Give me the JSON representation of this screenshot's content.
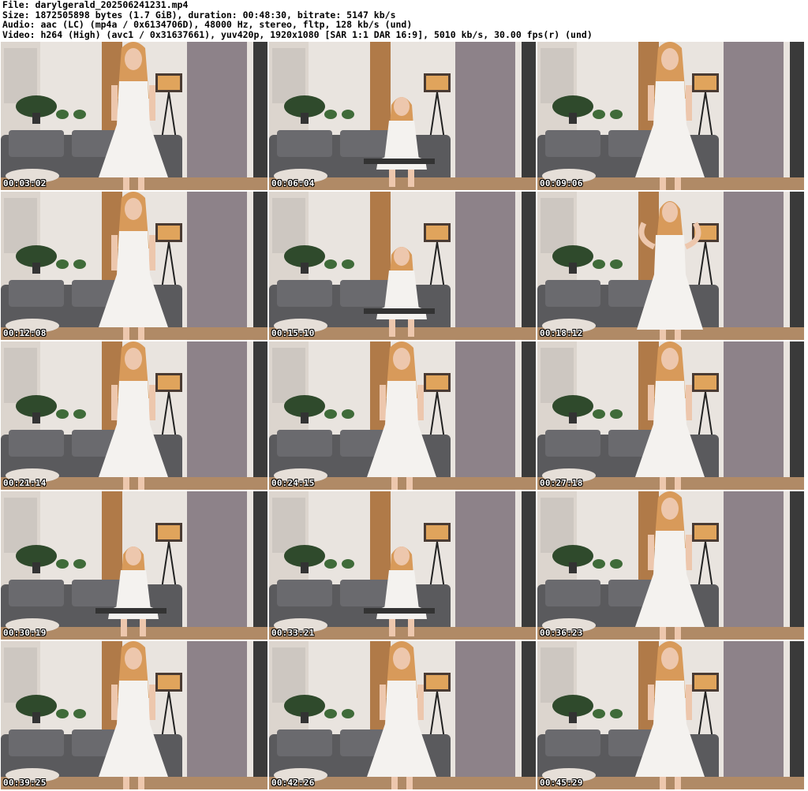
{
  "header": {
    "file_line": "File: darylgerald_202506241231.mp4",
    "size_line": "Size: 1872505898 bytes (1.7 GiB), duration: 00:48:30, bitrate: 5147 kb/s",
    "audio_line": "Audio: aac (LC) (mp4a / 0x6134706D), 48000 Hz, stereo, fltp, 128 kb/s (und)",
    "video_line": "Video: h264 (High) (avc1 / 0x31637661), yuv420p, 1920x1080 [SAR 1:1 DAR 16:9], 5010 kb/s, 30.00 fps(r) (und)"
  },
  "thumbnails": [
    {
      "time": "00:03:02",
      "pose": "standing"
    },
    {
      "time": "00:06:04",
      "pose": "sitting"
    },
    {
      "time": "00:09:06",
      "pose": "standing"
    },
    {
      "time": "00:12:08",
      "pose": "standing"
    },
    {
      "time": "00:15:10",
      "pose": "sitting"
    },
    {
      "time": "00:18:12",
      "pose": "arms-up"
    },
    {
      "time": "00:21:14",
      "pose": "standing"
    },
    {
      "time": "00:24:15",
      "pose": "standing"
    },
    {
      "time": "00:27:18",
      "pose": "standing"
    },
    {
      "time": "00:30:19",
      "pose": "sitting"
    },
    {
      "time": "00:33:21",
      "pose": "sitting"
    },
    {
      "time": "00:36:23",
      "pose": "standing"
    },
    {
      "time": "00:39:25",
      "pose": "standing"
    },
    {
      "time": "00:42:26",
      "pose": "standing"
    },
    {
      "time": "00:45:29",
      "pose": "standing"
    }
  ],
  "colors": {
    "wall": "#e9e4df",
    "curtain": "#8d8289",
    "couch": "#5a5a5d",
    "wood": "#b07a48",
    "dress": "#f4f2ef",
    "hair": "#d89a5a",
    "skin": "#edc7ad"
  }
}
